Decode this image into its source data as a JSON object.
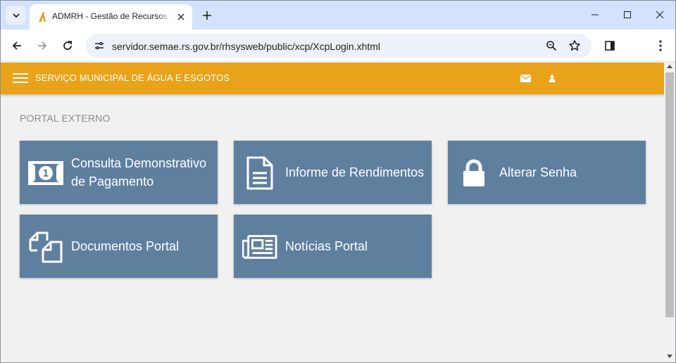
{
  "browser": {
    "tab": {
      "title": "ADMRH - Gestão de Recursos Humanos",
      "favicon": "admrh-logo-icon"
    },
    "address_bar": {
      "url": "servidor.semae.rs.gov.br/rhsysweb/public/xcp/XcpLogin.xhtml"
    },
    "icons": [
      "tab-search-icon",
      "close-icon",
      "plus-icon",
      "minimize-icon",
      "maximize-icon",
      "close-window-icon",
      "back-arrow-icon",
      "forward-arrow-icon",
      "reload-icon",
      "site-info-icon",
      "zoom-icon",
      "star-icon",
      "side-panel-icon",
      "kebab-menu-icon"
    ]
  },
  "app": {
    "header": {
      "title": "SERVIÇO MUNICIPAL DE ÁGUA E ESGOTOS",
      "color": "#e8a31a",
      "icons": [
        "menu-icon",
        "mail-icon",
        "user-icon"
      ]
    },
    "section_title": "PORTAL EXTERNO",
    "tiles": [
      {
        "label": "Consulta Demonstrativo de Pagamento",
        "icon": "money-bill-icon"
      },
      {
        "label": "Informe de Rendimentos",
        "icon": "document-icon"
      },
      {
        "label": "Alterar Senha",
        "icon": "lock-icon"
      },
      {
        "label": "Documentos Portal",
        "icon": "files-icon"
      },
      {
        "label": "Notícias Portal",
        "icon": "newspaper-icon"
      }
    ],
    "tile_color": "#5f7f9f"
  }
}
